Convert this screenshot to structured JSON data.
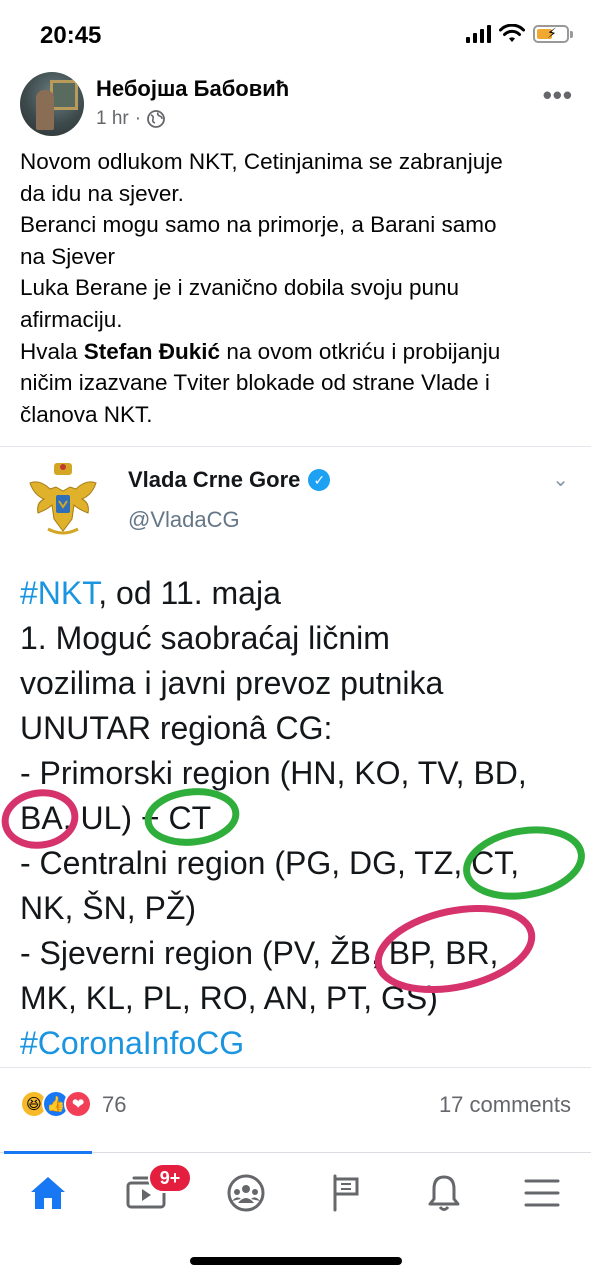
{
  "status_bar": {
    "time": "20:45"
  },
  "post": {
    "author": "Небојша Бабовић",
    "time_ago": "1 hr",
    "dot": "·",
    "privacy_icon": "globe-icon",
    "more_label": "•••",
    "text_lines": [
      "Novom odlukom NKT, Cetinjanima se zabranjuje",
      "da idu na sjever.",
      "Beranci mogu samo na primorje, a Barani samo",
      "na Sjever",
      "Luka Berane je i zvanično  dobila svoju punu",
      "afirmaciju."
    ],
    "thanks_prefix": "Hvala ",
    "thanks_name": "Stefan Đukić",
    "thanks_rest_line1": " na ovom otkriću i probijanju",
    "thanks_line2": "ničim izazvane Tviter  blokade od strane Vlade i",
    "thanks_line3": "članova NKT."
  },
  "tweet": {
    "account_name": "Vlada Crne Gore",
    "handle": "@VladaCG",
    "verified_mark": "✓",
    "chevron": "⌄",
    "hashtag_nkt": "#NKT",
    "line1_rest": ", od 11. maja",
    "line2": "1. Moguć saobraćaj ličnim",
    "line3": "vozilima i javni prevoz putnika",
    "line4": "UNUTAR regionâ CG:",
    "line5": "- Primorski region (HN, KO, TV, BD,",
    "line6": "BA, UL) + CT",
    "line7": "- Centralni region (PG, DG, TZ, CT,",
    "line8": "NK, ŠN, PŽ)",
    "line9": "- Sjeverni region (PV, ŽB, BP, BR,",
    "line10": "MK, KL, PL, RO, AN, PT, GS)",
    "hashtag_corona": "#CoronaInfoCG",
    "colors": {
      "hashtag": "#1b95e0",
      "magenta_circle": "#d6336c",
      "green_circle": "#2fae3b"
    }
  },
  "reactions": {
    "icons": [
      "haha-icon",
      "like-icon",
      "love-icon"
    ],
    "count": "76",
    "comments": "17 comments"
  },
  "nav": {
    "items": [
      "home-icon",
      "watch-icon",
      "groups-icon",
      "pages-flag-icon",
      "notifications-bell-icon",
      "menu-icon"
    ],
    "watch_badge": "9+",
    "active": "home-icon",
    "accent": "#1877f2"
  }
}
